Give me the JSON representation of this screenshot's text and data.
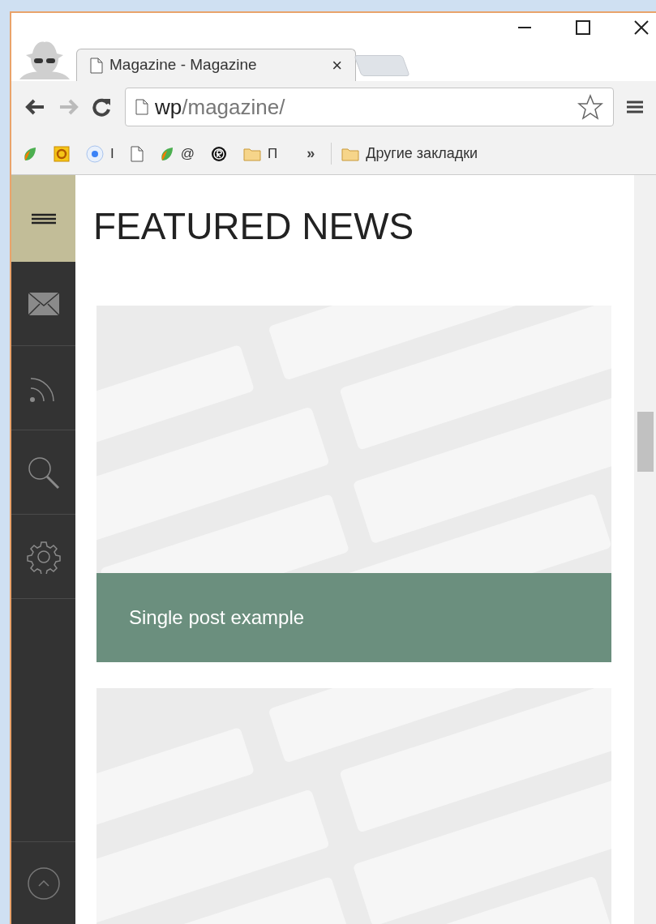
{
  "tab": {
    "title": "Magazine - Magazine",
    "close": "×",
    "selected": true
  },
  "address": {
    "host": "wp",
    "path": "/magazine/"
  },
  "bookmarks": [
    {
      "kind": "leaf"
    },
    {
      "kind": "orange-square"
    },
    {
      "kind": "blue-dot",
      "label": "I"
    },
    {
      "kind": "page"
    },
    {
      "kind": "leaf",
      "label": "@"
    },
    {
      "kind": "black-circle"
    },
    {
      "kind": "folder",
      "label": "П"
    }
  ],
  "bookmarks_more": "»",
  "other_bookmarks": "Другие закладки",
  "sidebar": {
    "items": [
      {
        "kind": "mail"
      },
      {
        "kind": "rss"
      },
      {
        "kind": "search"
      },
      {
        "kind": "settings"
      }
    ]
  },
  "heading": "FEATURED NEWS",
  "posts": [
    {
      "kind": "picture",
      "caption": "Single post example"
    },
    {
      "kind": "picture"
    }
  ]
}
